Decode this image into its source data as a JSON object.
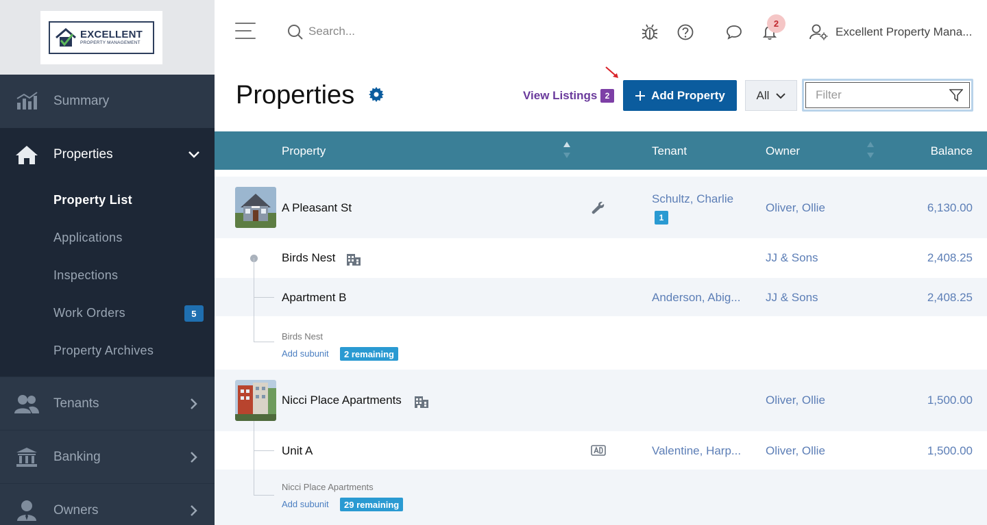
{
  "brand": {
    "logo_big": "EXCELLENT",
    "logo_small": "PROPERTY MANAGEMENT"
  },
  "sidebar": {
    "items": [
      {
        "label": "Summary",
        "icon": "chart-icon"
      },
      {
        "label": "Properties",
        "icon": "home-icon",
        "expanded": true
      },
      {
        "label": "Tenants",
        "icon": "users-icon"
      },
      {
        "label": "Banking",
        "icon": "bank-icon"
      },
      {
        "label": "Owners",
        "icon": "owner-icon"
      }
    ],
    "sub_items": [
      {
        "label": "Property List",
        "active": true
      },
      {
        "label": "Applications"
      },
      {
        "label": "Inspections"
      },
      {
        "label": "Work Orders",
        "badge": "5"
      },
      {
        "label": "Property Archives"
      }
    ]
  },
  "topbar": {
    "search_placeholder": "Search...",
    "notifications_count": "2",
    "account_name": "Excellent Property Mana..."
  },
  "page": {
    "title": "Properties",
    "view_listings": "View Listings",
    "view_listings_count": "2",
    "add_property": "Add Property",
    "scope_select": "All",
    "filter_placeholder": "Filter"
  },
  "table": {
    "headers": {
      "property": "Property",
      "tenant": "Tenant",
      "owner": "Owner",
      "balance": "Balance"
    },
    "rows": [
      {
        "name": "A Pleasant St",
        "tenant": "Schultz, Charlie",
        "tenant_badge": "1",
        "owner": "Oliver, Ollie",
        "balance": "6,130.00"
      },
      {
        "name": "Birds Nest",
        "tenant": "",
        "owner": "JJ & Sons",
        "balance": "2,408.25"
      },
      {
        "name": "Apartment B",
        "tenant": "Anderson, Abig...",
        "owner": "JJ & Sons",
        "balance": "2,408.25"
      },
      {
        "parent": "Birds Nest",
        "add_subunit": "Add subunit",
        "remaining": "2 remaining"
      },
      {
        "name": "Nicci Place Apartments",
        "tenant": "",
        "owner": "Oliver, Ollie",
        "balance": "1,500.00"
      },
      {
        "name": "Unit A",
        "tenant": "Valentine, Harp...",
        "owner": "Oliver, Ollie",
        "balance": "1,500.00"
      },
      {
        "parent": "Nicci Place Apartments",
        "add_subunit": "Add subunit",
        "remaining": "29 remaining"
      }
    ]
  },
  "colors": {
    "sidebar": "#253140",
    "header": "#3a7f97",
    "primary": "#0b5c9e",
    "link": "#5c7eb6",
    "badge": "#2a9ad2"
  }
}
